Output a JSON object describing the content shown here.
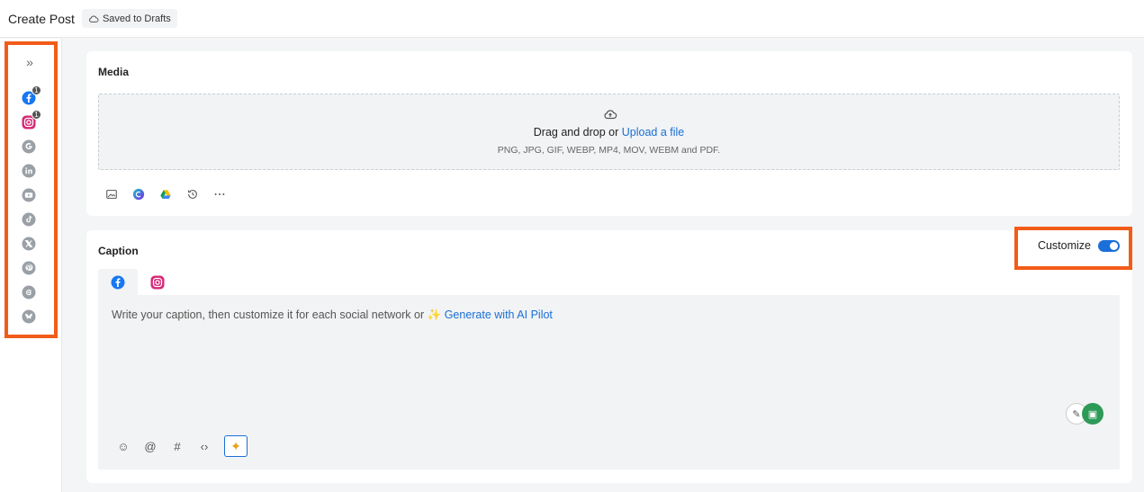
{
  "header": {
    "title": "Create Post",
    "draft_status": "Saved to Drafts"
  },
  "sidebar": {
    "expand_glyph": "»",
    "networks": [
      {
        "name": "facebook",
        "badge": "1",
        "color": "#1877f2"
      },
      {
        "name": "instagram",
        "badge": "1",
        "color": "#d62976"
      },
      {
        "name": "google",
        "color": "#9aa0a6"
      },
      {
        "name": "linkedin",
        "color": "#9aa0a6"
      },
      {
        "name": "youtube",
        "color": "#9aa0a6"
      },
      {
        "name": "tiktok",
        "color": "#9aa0a6"
      },
      {
        "name": "x",
        "color": "#9aa0a6"
      },
      {
        "name": "pinterest",
        "color": "#9aa0a6"
      },
      {
        "name": "threads",
        "color": "#9aa0a6"
      },
      {
        "name": "bluesky",
        "color": "#9aa0a6"
      }
    ]
  },
  "media": {
    "title": "Media",
    "drop_text": "Drag and drop or ",
    "upload_link": "Upload a file",
    "formats": "PNG, JPG, GIF, WEBP, MP4, MOV, WEBM and PDF.",
    "tools": [
      "image-icon",
      "canva-icon",
      "google-drive-icon",
      "history-icon",
      "more-icon"
    ]
  },
  "caption": {
    "title": "Caption",
    "customize_label": "Customize",
    "customize_on": true,
    "tabs": [
      "facebook",
      "instagram"
    ],
    "placeholder_text": "Write your caption, then customize it for each social network or ",
    "ai_spark": "✨",
    "ai_link": "Generate with AI Pilot",
    "tools": {
      "emoji": "☺",
      "mention": "@",
      "hashtag": "#",
      "code": "‹›",
      "ai": "✦"
    }
  },
  "colors": {
    "accent": "#1a6fd8",
    "highlight": "#f25c19",
    "assistant_green": "#2e9a57"
  }
}
